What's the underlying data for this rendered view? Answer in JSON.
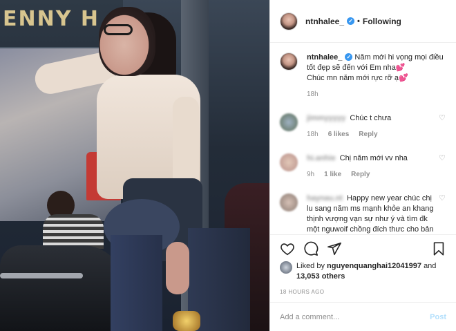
{
  "header": {
    "username": "ntnhalee_",
    "separator": "•",
    "following_label": "Following"
  },
  "caption": {
    "username": "ntnhalee_",
    "text_line1": "Năm mới hi vọng mọi điều tốt đẹp sẽ đến với Em nha",
    "heart1": "💕",
    "text_line2": "Chúc mn năm mới rực rỡ ạ",
    "heart2": "💕",
    "time": "18h"
  },
  "comments": [
    {
      "username": "jimmyyyyy",
      "text": "Chúc t chưa",
      "time": "18h",
      "likes": "6 likes",
      "reply": "Reply"
    },
    {
      "username": "hi.anhie",
      "text": "Chị năm mới vv nha",
      "time": "9h",
      "likes": "1 like",
      "reply": "Reply"
    },
    {
      "username": "haynau.nt",
      "text": "Happy new year chúc chị lu sang năm ms mạnh khỏe an khang thịnh vượng vạn sự như ý và tìm đk một nguwoif chồng đích thưc cho bản thân mik chi nhé",
      "heart": "❤️"
    }
  ],
  "likes": {
    "prefix": "Liked by",
    "user": "nguyenquanghai12041997",
    "joiner": "and",
    "others": "13,053 others"
  },
  "timestamp": "18 HOURS AGO",
  "add_comment": {
    "placeholder": "Add a comment...",
    "post_label": "Post"
  },
  "icons": {
    "like": "heart-outline-icon",
    "comment": "speech-bubble-icon",
    "share": "paper-plane-icon",
    "save": "bookmark-icon",
    "verified": "verified-badge-icon",
    "comment_like": "small-heart-icon"
  },
  "colors": {
    "verified_blue": "#3897f0",
    "meta_gray": "#8e8e8e",
    "post_disabled": "#b2dffc",
    "text": "#262626"
  }
}
